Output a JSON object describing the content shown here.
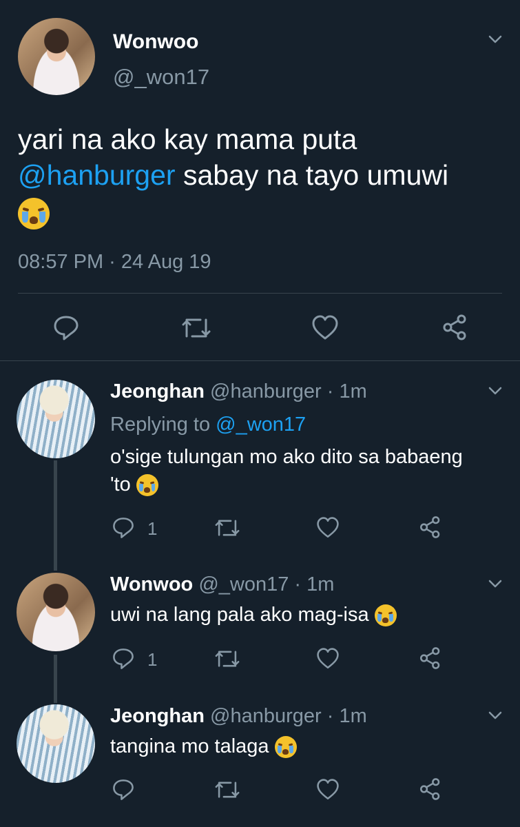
{
  "main_tweet": {
    "name": "Wonwoo",
    "handle": "@_won17",
    "text_line1": "yari na ako kay mama puta",
    "mention": "@hanburger",
    "text_line2_rest": " sabay na tayo umuwi",
    "timestamp": "08:57 PM · 24 Aug 19"
  },
  "replies": [
    {
      "name": "Jeonghan",
      "handle": "@hanburger",
      "sep_time": " · 1m",
      "replying_label": "Replying to ",
      "replying_handle": "@_won17",
      "text_line1": "o'sige tulungan mo ako dito sa babaeng",
      "text_line2": "'to",
      "reply_count": "1"
    },
    {
      "name": "Wonwoo",
      "handle": "@_won17",
      "sep_time": " · 1m",
      "text": "uwi na lang pala ako mag-isa",
      "reply_count": "1"
    },
    {
      "name": "Jeonghan",
      "handle": "@hanburger",
      "sep_time": " · 1m",
      "text": "tangina mo talaga"
    }
  ],
  "icons": [
    "chevron-down-icon",
    "reply-icon",
    "retweet-icon",
    "like-icon",
    "share-icon",
    "crying-face-emoji"
  ],
  "colors": {
    "background": "#15202b",
    "link": "#1da1f2",
    "muted": "#8899a6",
    "divider": "#38444d"
  }
}
